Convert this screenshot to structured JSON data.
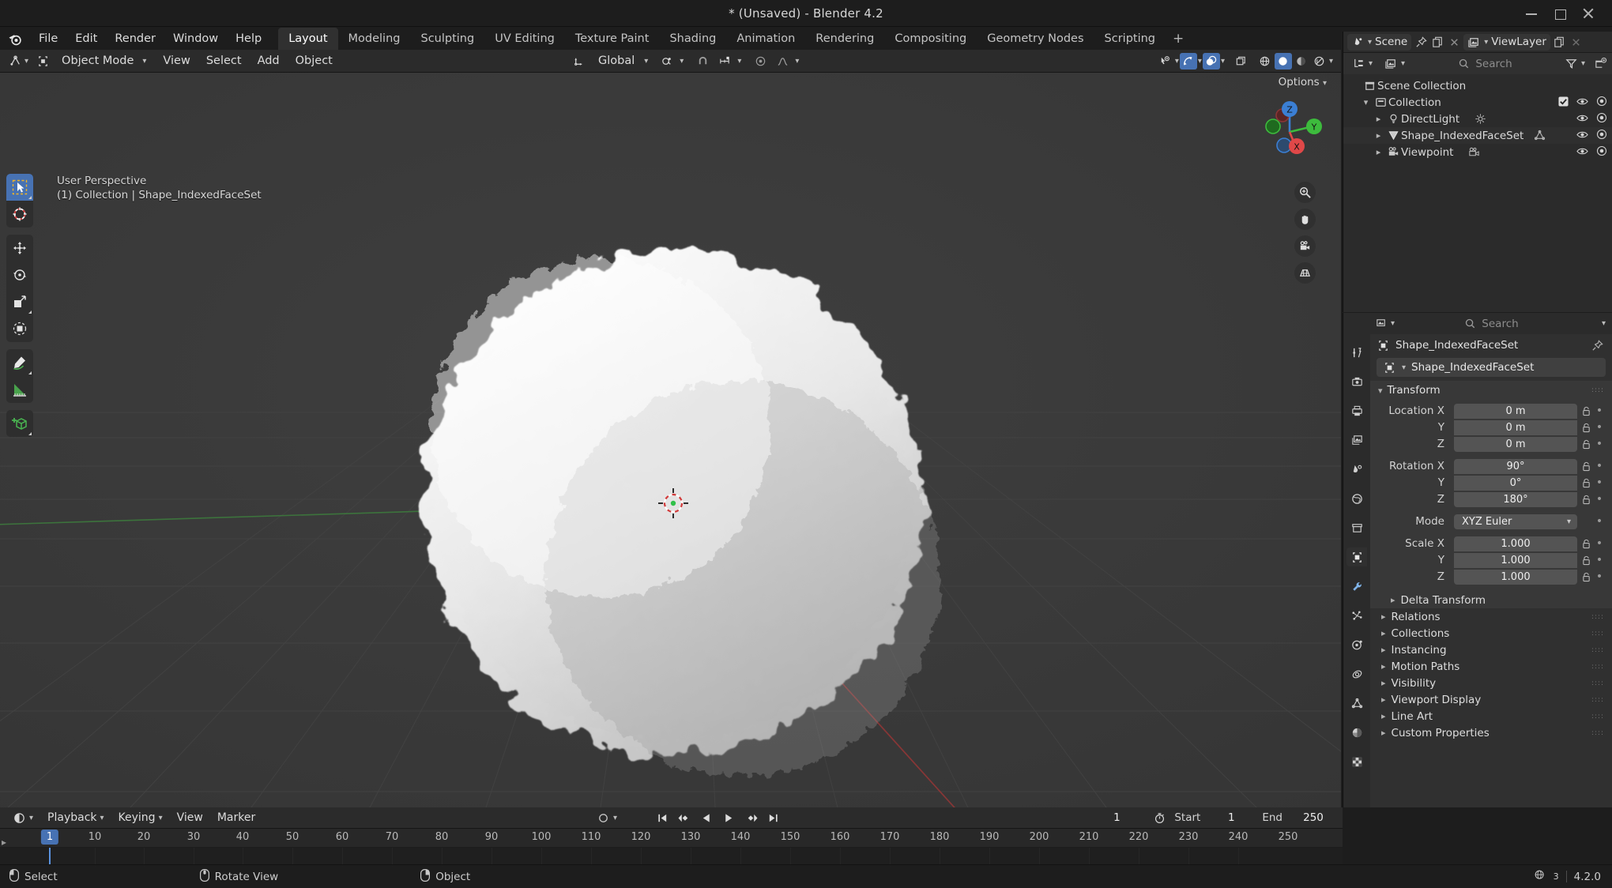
{
  "window": {
    "title": "* (Unsaved) - Blender 4.2",
    "minimize_label": "Minimize",
    "maximize_label": "Maximize",
    "close_label": "Close"
  },
  "topbar": {
    "app_icon": "blender-logo-icon",
    "menus": [
      "File",
      "Edit",
      "Render",
      "Window",
      "Help"
    ],
    "workspaces": [
      {
        "label": "Layout",
        "active": true
      },
      {
        "label": "Modeling",
        "active": false
      },
      {
        "label": "Sculpting",
        "active": false
      },
      {
        "label": "UV Editing",
        "active": false
      },
      {
        "label": "Texture Paint",
        "active": false
      },
      {
        "label": "Shading",
        "active": false
      },
      {
        "label": "Animation",
        "active": false
      },
      {
        "label": "Rendering",
        "active": false
      },
      {
        "label": "Compositing",
        "active": false
      },
      {
        "label": "Geometry Nodes",
        "active": false
      },
      {
        "label": "Scripting",
        "active": false
      }
    ],
    "add_workspace": "+"
  },
  "viewport_header": {
    "editor_type_icon": "editor-type-3dview-icon",
    "mode": "Object Mode",
    "menus": [
      "View",
      "Select",
      "Add",
      "Object"
    ],
    "transform_orientation": "Global",
    "snap_icon": "magnet-icon",
    "proportional_icon": "proportional-editing-icon",
    "options_label": "Options"
  },
  "viewport": {
    "perspective_label": "User Perspective",
    "context_label": "(1) Collection | Shape_IndexedFaceSet",
    "gizmo_axes": [
      {
        "name": "Z",
        "color": "#3b7fd4"
      },
      {
        "name": "Y",
        "color": "#3dbb3d"
      },
      {
        "name": "X",
        "color": "#e04848"
      }
    ],
    "nav_buttons": [
      "zoom-icon",
      "pan-hand-icon",
      "camera-view-icon",
      "toggle-ortho-icon"
    ],
    "toolbar_tools": [
      {
        "name": "tweak-select-box-tool",
        "active": true
      },
      {
        "name": "cursor-tool",
        "active": false
      },
      {
        "name": "move-tool",
        "active": false
      },
      {
        "name": "rotate-tool",
        "active": false
      },
      {
        "name": "scale-tool",
        "active": false
      },
      {
        "name": "transform-tool",
        "active": false
      },
      {
        "name": "annotate-tool",
        "active": false
      },
      {
        "name": "measure-tool",
        "active": false
      },
      {
        "name": "add-cube-tool",
        "active": false
      }
    ],
    "select_mode_icons": [
      "select-box-icon",
      "select-circle-icon",
      "select-lasso-icon",
      "select-extend-icon",
      "select-intersect-icon"
    ],
    "shading_modes": [
      "wireframe",
      "solid",
      "material-preview",
      "rendered"
    ],
    "active_shading": "solid",
    "object_name": "Shape_IndexedFaceSet"
  },
  "outliner": {
    "scene_dropdown_icon": "scene-icon",
    "scene_name": "Scene",
    "viewlayer_icon": "viewlayer-icon",
    "viewlayer_name": "ViewLayer",
    "display_mode_icon": "outliner-display-mode-icon",
    "filter_icon": "filter-funnel-icon",
    "new_collection_icon": "new-collection-icon",
    "search_placeholder": "Search",
    "rows": [
      {
        "label": "Scene Collection",
        "icon": "scene-collection-icon",
        "indent": 0,
        "expandable": false,
        "checkbox": false,
        "eye": false,
        "camera": false
      },
      {
        "label": "Collection",
        "icon": "collection-icon",
        "indent": 1,
        "expandable": true,
        "expanded": true,
        "checkbox": true,
        "eye": true,
        "camera": true
      },
      {
        "label": "DirectLight",
        "icon": "light-object-icon",
        "indent": 2,
        "expandable": true,
        "expanded": false,
        "data_icon": "light-data-icon",
        "checkbox": false,
        "eye": true,
        "camera": true
      },
      {
        "label": "Shape_IndexedFaceSet",
        "icon": "mesh-object-icon",
        "indent": 2,
        "expandable": true,
        "expanded": false,
        "data_icon": "mesh-data-icon",
        "selected": true,
        "checkbox": false,
        "eye": true,
        "camera": true
      },
      {
        "label": "Viewpoint",
        "icon": "camera-object-icon",
        "indent": 2,
        "expandable": true,
        "expanded": false,
        "data_icon": "camera-data-icon",
        "checkbox": false,
        "eye": true,
        "camera": true
      }
    ]
  },
  "properties": {
    "search_placeholder": "Search",
    "breadcrumb_object": "Shape_IndexedFaceSet",
    "id_block_name": "Shape_IndexedFaceSet",
    "tabs": [
      {
        "name": "tool-tab",
        "icon": "tool-icon",
        "active": false
      },
      {
        "name": "render-tab",
        "icon": "render-camera-icon",
        "active": false
      },
      {
        "name": "output-tab",
        "icon": "printer-output-icon",
        "active": false
      },
      {
        "name": "viewlayer-tab",
        "icon": "images-viewlayer-icon",
        "active": false
      },
      {
        "name": "scene-tab",
        "icon": "scene-cone-icon",
        "active": false
      },
      {
        "name": "world-tab",
        "icon": "world-globe-icon",
        "active": false
      },
      {
        "name": "collection-tab",
        "icon": "collection-box-icon",
        "active": false
      },
      {
        "name": "object-tab",
        "icon": "object-square-icon",
        "active": true
      },
      {
        "name": "modifier-tab",
        "icon": "wrench-icon",
        "active": false
      },
      {
        "name": "particles-tab",
        "icon": "particles-icon",
        "active": false
      },
      {
        "name": "physics-tab",
        "icon": "physics-orbit-icon",
        "active": false
      },
      {
        "name": "constraints-tab",
        "icon": "constraint-icon",
        "active": false
      },
      {
        "name": "data-tab",
        "icon": "mesh-data-triangle-icon",
        "active": false
      },
      {
        "name": "material-tab",
        "icon": "material-sphere-icon",
        "active": false
      },
      {
        "name": "texture-tab",
        "icon": "texture-checker-icon",
        "active": false
      }
    ],
    "transform": {
      "title": "Transform",
      "expanded": true,
      "location": {
        "label": "Location",
        "axes": [
          "X",
          "Y",
          "Z"
        ],
        "values": [
          "0 m",
          "0 m",
          "0 m"
        ]
      },
      "rotation": {
        "label": "Rotation",
        "axes": [
          "X",
          "Y",
          "Z"
        ],
        "values": [
          "90°",
          "0°",
          "180°"
        ]
      },
      "mode": {
        "label": "Mode",
        "value": "XYZ Euler"
      },
      "scale": {
        "label": "Scale",
        "axes": [
          "X",
          "Y",
          "Z"
        ],
        "values": [
          "1.000",
          "1.000",
          "1.000"
        ]
      }
    },
    "sub_panels": [
      {
        "label": "Delta Transform",
        "sub": true
      },
      {
        "label": "Relations",
        "sub": false
      },
      {
        "label": "Collections",
        "sub": false
      },
      {
        "label": "Instancing",
        "sub": false
      },
      {
        "label": "Motion Paths",
        "sub": false
      },
      {
        "label": "Visibility",
        "sub": false
      },
      {
        "label": "Viewport Display",
        "sub": false
      },
      {
        "label": "Line Art",
        "sub": false
      },
      {
        "label": "Custom Properties",
        "sub": false
      }
    ]
  },
  "timeline": {
    "editor_icon": "timeline-editor-icon",
    "menus": [
      "Playback",
      "Keying",
      "View",
      "Marker"
    ],
    "auto_key_icon": "record-circle-icon",
    "playback_buttons": [
      "jump-to-start",
      "jump-prev-keyframe",
      "play-reverse",
      "play",
      "jump-next-keyframe",
      "jump-to-end"
    ],
    "current_frame": "1",
    "timer_icon": "stopwatch-icon",
    "start_label": "Start",
    "start_value": "1",
    "end_label": "End",
    "end_value": "250",
    "ticks": [
      "10",
      "20",
      "30",
      "40",
      "50",
      "60",
      "70",
      "80",
      "90",
      "100",
      "110",
      "120",
      "130",
      "140",
      "150",
      "160",
      "170",
      "180",
      "190",
      "200",
      "210",
      "220",
      "230",
      "240",
      "250"
    ],
    "playhead_frame": "1"
  },
  "statusbar": {
    "items": [
      {
        "icon": "mouse-left-icon",
        "label": "Select"
      },
      {
        "icon": "mouse-middle-icon",
        "label": "Rotate View"
      },
      {
        "icon": "mouse-right-icon",
        "label": "Object"
      }
    ],
    "scene_stats_icon": "globe-scene-icon",
    "scene_stats_sub": "3",
    "version": "4.2.0"
  },
  "colors": {
    "accent_blue": "#4772b3",
    "viewport_bg": "#393939",
    "panel_bg": "#303030",
    "header_bg": "#2b2b2b",
    "axis_x": "#e04848",
    "axis_y": "#3dbb3d",
    "axis_z": "#3b7fd4"
  }
}
